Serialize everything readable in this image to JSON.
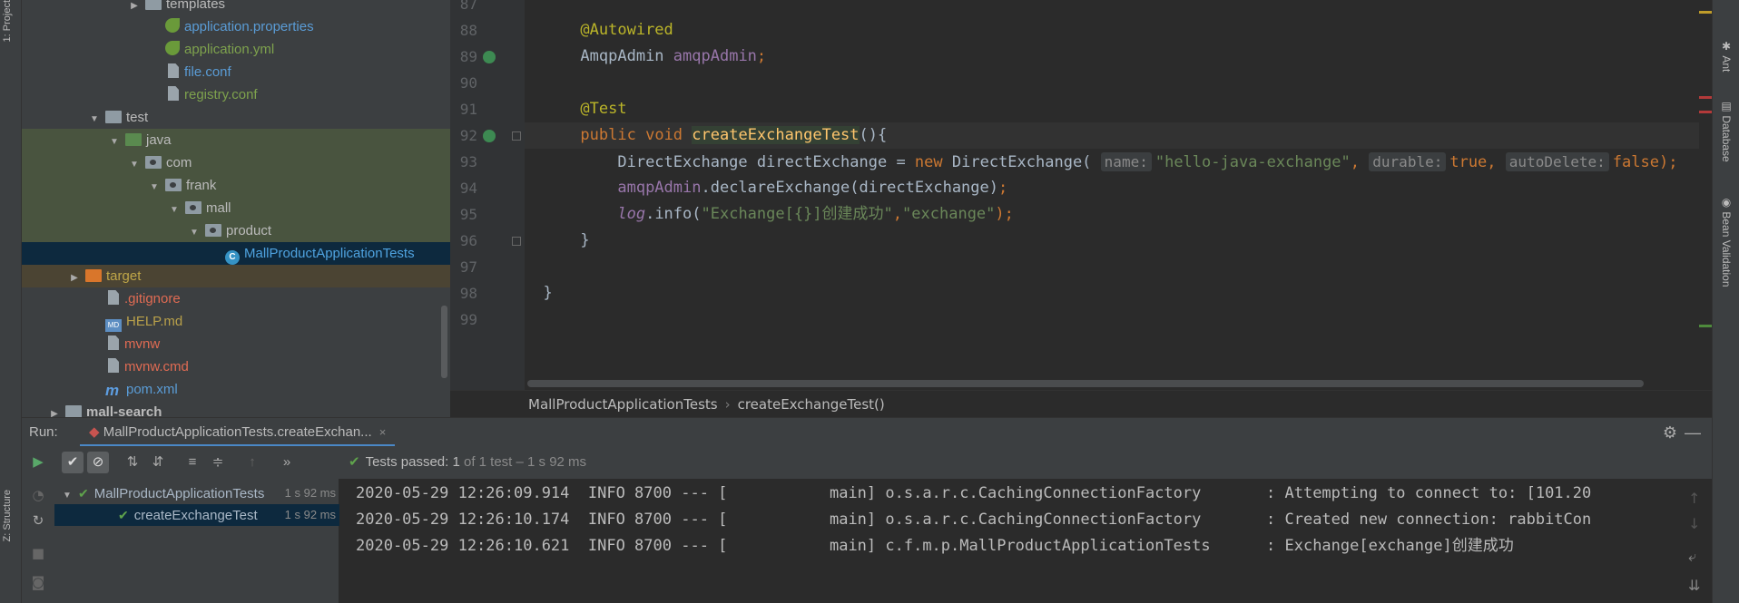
{
  "left_strip": {
    "project_tab": "1: Project",
    "structure_tab": "Z: Structure"
  },
  "project_tree": [
    {
      "label": "templates",
      "icon": "folder-icon",
      "color": "plain",
      "indent": 5,
      "toggle": "▶"
    },
    {
      "label": "application.properties",
      "icon": "spring-leaf-icon",
      "color": "blue",
      "indent": 6,
      "toggle": ""
    },
    {
      "label": "application.yml",
      "icon": "spring-leaf-icon",
      "color": "green",
      "indent": 6,
      "toggle": ""
    },
    {
      "label": "file.conf",
      "icon": "file-icon",
      "color": "blue",
      "indent": 6,
      "toggle": ""
    },
    {
      "label": "registry.conf",
      "icon": "file-icon",
      "color": "green",
      "indent": 6,
      "toggle": ""
    },
    {
      "label": "test",
      "icon": "folder-icon",
      "color": "plain",
      "indent": 3,
      "toggle": "▼"
    },
    {
      "label": "java",
      "icon": "test-source-folder-icon",
      "color": "plain",
      "indent": 4,
      "toggle": "▼",
      "bg": "green"
    },
    {
      "label": "com",
      "icon": "package-icon",
      "color": "plain",
      "indent": 5,
      "toggle": "▼",
      "bg": "green"
    },
    {
      "label": "frank",
      "icon": "package-icon",
      "color": "plain",
      "indent": 6,
      "toggle": "▼",
      "bg": "green"
    },
    {
      "label": "mall",
      "icon": "package-icon",
      "color": "plain",
      "indent": 7,
      "toggle": "▼",
      "bg": "green"
    },
    {
      "label": "product",
      "icon": "package-icon",
      "color": "plain",
      "indent": 8,
      "toggle": "▼",
      "bg": "green"
    },
    {
      "label": "MallProductApplicationTests",
      "icon": "class-icon",
      "color": "sel",
      "indent": 9,
      "toggle": "",
      "bg": "sel"
    },
    {
      "label": "target",
      "icon": "excluded-folder-icon",
      "color": "olive",
      "indent": 2,
      "toggle": "▶",
      "bg": "excl"
    },
    {
      "label": ".gitignore",
      "icon": "file-icon",
      "color": "red",
      "indent": 3,
      "toggle": ""
    },
    {
      "label": "HELP.md",
      "icon": "markdown-icon",
      "color": "yellow",
      "indent": 3,
      "toggle": ""
    },
    {
      "label": "mvnw",
      "icon": "file-icon",
      "color": "red",
      "indent": 3,
      "toggle": ""
    },
    {
      "label": "mvnw.cmd",
      "icon": "file-icon",
      "color": "red",
      "indent": 3,
      "toggle": ""
    },
    {
      "label": "pom.xml",
      "icon": "maven-icon",
      "color": "blue",
      "indent": 3,
      "toggle": ""
    },
    {
      "label": "mall-search",
      "icon": "module-folder-icon",
      "color": "plain",
      "indent": 1,
      "toggle": "▶"
    }
  ],
  "editor": {
    "lines": [
      {
        "num": "87"
      },
      {
        "num": "88",
        "code": "annotation-autowired"
      },
      {
        "num": "89",
        "code": "field"
      },
      {
        "num": "90"
      },
      {
        "num": "91",
        "code": "annotation-test"
      },
      {
        "num": "92",
        "code": "method-sig"
      },
      {
        "num": "93",
        "code": "stmt1"
      },
      {
        "num": "94",
        "code": "stmt2"
      },
      {
        "num": "95",
        "code": "stmt3"
      },
      {
        "num": "96",
        "code": "close-brace"
      },
      {
        "num": "97"
      },
      {
        "num": "98",
        "code": "class-close"
      },
      {
        "num": "99"
      }
    ],
    "tokens": {
      "autowired": "@Autowired",
      "field_type": "AmqpAdmin",
      "field_name": "amqpAdmin",
      "semi": ";",
      "test": "@Test",
      "public": "public",
      "void": "void",
      "method_name": "createExchangeTest",
      "method_paren": "(){",
      "de_type": "DirectExchange",
      "de_var": "directExchange",
      "assign": " = ",
      "new": "new",
      "de_ctor": "DirectExchange(",
      "hint_name": "name:",
      "arg_name": "\"hello-java-exchange\"",
      "comma": ",",
      "hint_durable": "durable:",
      "arg_true": "true",
      "hint_autodelete": "autoDelete:",
      "arg_false": "false",
      "close_stmt": ");",
      "amqp_ref": "amqpAdmin",
      "declare_call": ".declareExchange(directExchange)",
      "log": "log",
      "info_call": ".info(",
      "log_msg": "\"Exchange[{}]创建成功\"",
      "log_arg": "\"exchange\"",
      "brace_close": "}"
    }
  },
  "breadcrumb": {
    "class": "MallProductApplicationTests",
    "separator": "›",
    "method": "createExchangeTest()"
  },
  "right_strip": {
    "tabs": [
      "Ant",
      "Database",
      "Bean Validation"
    ]
  },
  "run_panel": {
    "label": "Run:",
    "tab_title": "MallProductApplicationTests.createExchan...",
    "tab_close": "×",
    "status_prefix": "Tests passed:",
    "status_count": "1",
    "status_detail": "of 1 test – 1 s 92 ms",
    "tree": [
      {
        "label": "MallProductApplicationTests",
        "duration": "1 s 92 ms",
        "toggle": "▼",
        "level": 0
      },
      {
        "label": "createExchangeTest",
        "duration": "1 s 92 ms",
        "toggle": "",
        "level": 1
      }
    ],
    "console": [
      "2020-05-29 12:26:09.914  INFO 8700 --- [           main] o.s.a.r.c.CachingConnectionFactory       : Attempting to connect to: [101.20",
      "2020-05-29 12:26:10.174  INFO 8700 --- [           main] o.s.a.r.c.CachingConnectionFactory       : Created new connection: rabbitCon",
      "2020-05-29 12:26:10.621  INFO 8700 --- [           main] c.f.m.p.MallProductApplicationTests      : Exchange[exchange]创建成功"
    ]
  },
  "colors": {
    "keyword": "#cc7832",
    "annotation": "#bbb529",
    "string": "#6a8759",
    "field": "#9876aa",
    "method": "#ffc66d",
    "pass": "#5fa34c"
  }
}
